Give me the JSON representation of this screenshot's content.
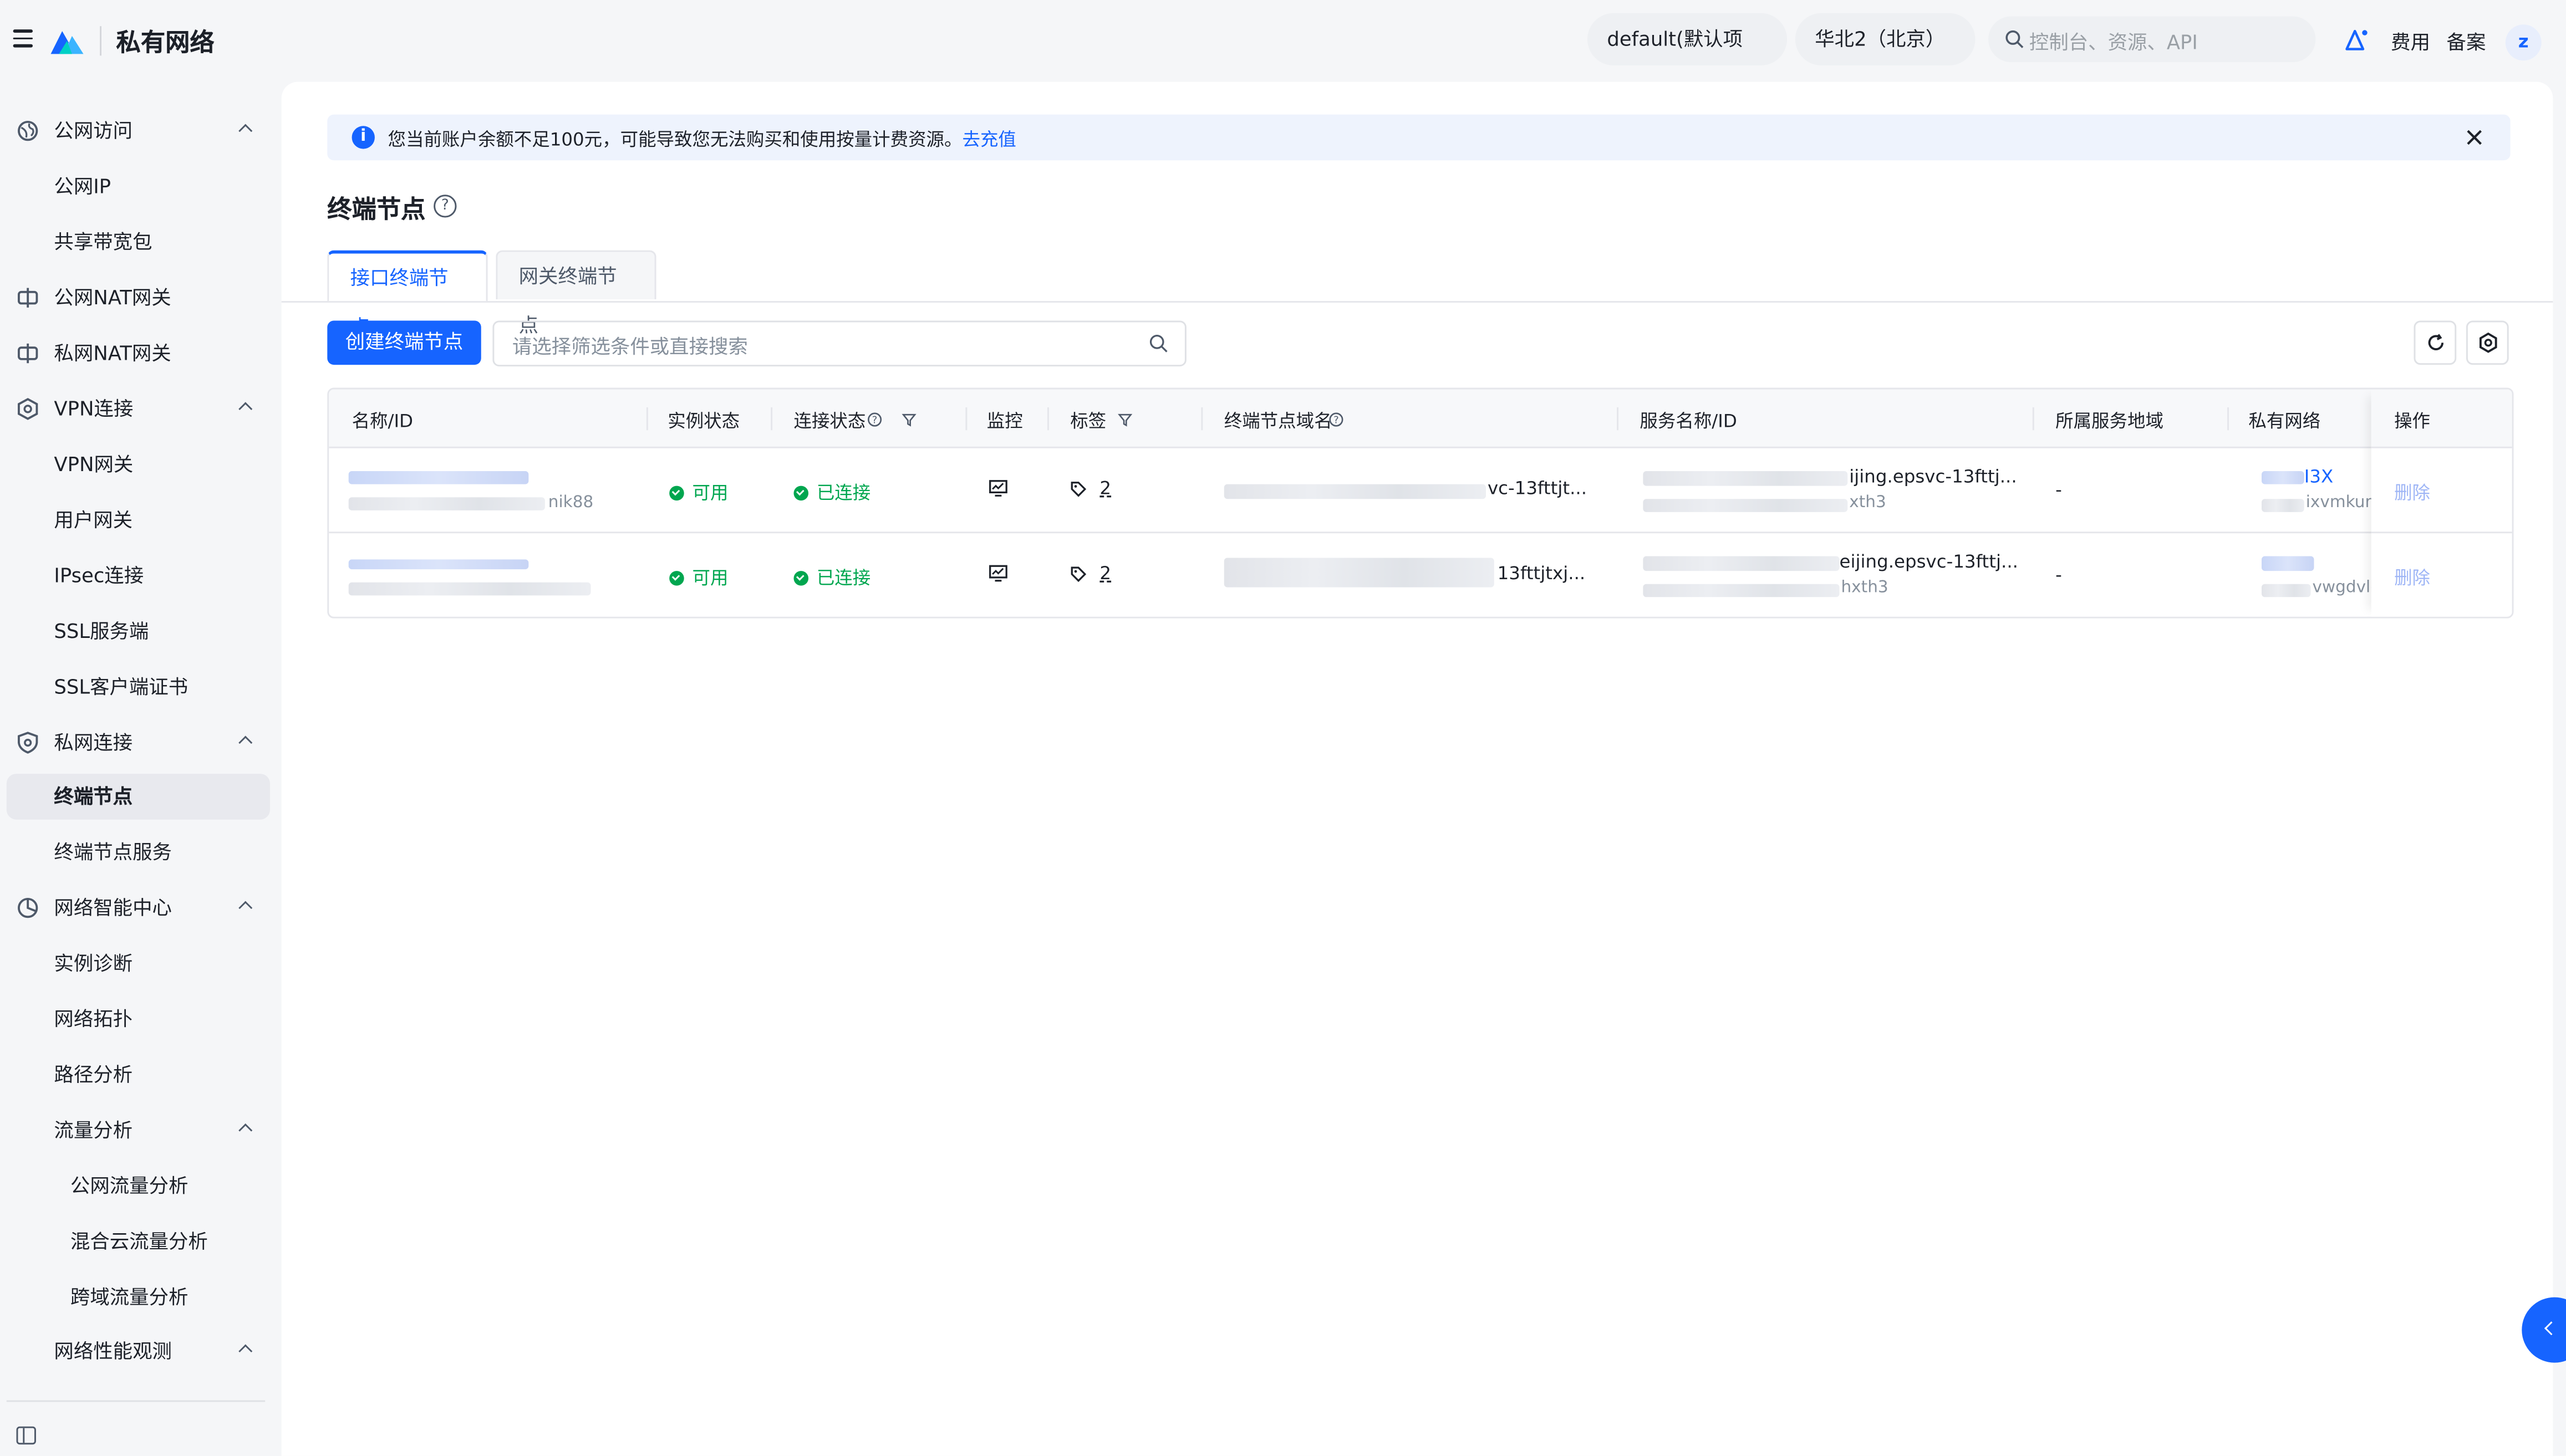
{
  "header": {
    "app_title": "私有网络",
    "project_selector": "default(默认项目)",
    "region_selector": "华北2（北京）",
    "search_placeholder": "控制台、资源、API",
    "links": [
      "费用",
      "备案"
    ],
    "avatar_letter": "z"
  },
  "sidebar": {
    "items": [
      {
        "label": "公网访问",
        "icon": "globe-icon",
        "type": "group"
      },
      {
        "label": "公网IP",
        "type": "sub"
      },
      {
        "label": "共享带宽包",
        "type": "sub"
      },
      {
        "label": "公网NAT网关",
        "icon": "nat-icon",
        "type": "group"
      },
      {
        "label": "私网NAT网关",
        "icon": "nat-icon",
        "type": "group"
      },
      {
        "label": "VPN连接",
        "icon": "vpn-icon",
        "type": "group"
      },
      {
        "label": "VPN网关",
        "type": "sub"
      },
      {
        "label": "用户网关",
        "type": "sub"
      },
      {
        "label": "IPsec连接",
        "type": "sub"
      },
      {
        "label": "SSL服务端",
        "type": "sub"
      },
      {
        "label": "SSL客户端证书",
        "type": "sub"
      },
      {
        "label": "私网连接",
        "icon": "shield-icon",
        "type": "group"
      },
      {
        "label": "终端节点",
        "type": "sub",
        "active": true
      },
      {
        "label": "终端节点服务",
        "type": "sub"
      },
      {
        "label": "网络智能中心",
        "icon": "intelligence-icon",
        "type": "group"
      },
      {
        "label": "实例诊断",
        "type": "sub"
      },
      {
        "label": "网络拓扑",
        "type": "sub"
      },
      {
        "label": "路径分析",
        "type": "sub"
      },
      {
        "label": "流量分析",
        "type": "sub-group"
      },
      {
        "label": "公网流量分析",
        "type": "sub2"
      },
      {
        "label": "混合云流量分析",
        "type": "sub2"
      },
      {
        "label": "跨域流量分析",
        "type": "sub2"
      },
      {
        "label": "网络性能观测",
        "type": "sub-group"
      }
    ]
  },
  "alert": {
    "message": "您当前账户余额不足100元，可能导致您无法购买和使用按量计费资源。",
    "link": "去充值"
  },
  "page": {
    "title": "终端节点",
    "tabs": [
      "接口终端节点",
      "网关终端节点"
    ],
    "create_button": "创建终端节点",
    "filter_placeholder": "请选择筛选条件或直接搜索"
  },
  "table": {
    "columns": [
      "名称/ID",
      "实例状态",
      "连接状态",
      "监控",
      "标签",
      "终端节点域名",
      "服务名称/ID",
      "所属服务地域",
      "私有网络",
      "操作"
    ],
    "rows": [
      {
        "id_suffix": "nik88",
        "instance_status": "可用",
        "connection_status": "已连接",
        "tag_count": "2",
        "domain_suffix": "vc-13fttjt...",
        "service_name": "ijing.epsvc-13fttj...",
        "service_id_suffix": "xth3",
        "region": "-",
        "vpc_name_suffix": "I3X",
        "vpc_id_suffix": "ixvmkum",
        "action": "删除"
      },
      {
        "id_suffix": "",
        "instance_status": "可用",
        "connection_status": "已连接",
        "tag_count": "2",
        "domain_suffix": "13fttjtxj...",
        "service_name": "eijing.epsvc-13fttj...",
        "service_id_suffix": "hxth3",
        "region": "-",
        "vpc_name_suffix": "",
        "vpc_id_suffix": "vwgdvlg",
        "action": "删除"
      }
    ]
  },
  "colors": {
    "brand": "#1664ff",
    "success": "#00a64f",
    "background": "#f5f6f8"
  }
}
